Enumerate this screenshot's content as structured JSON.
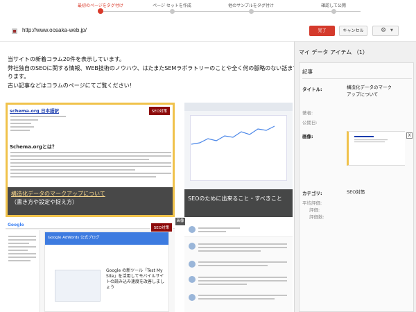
{
  "stepper": {
    "steps": [
      "最初のページをタグ付け",
      "ページ セットを作成",
      "他のサンプルをタグ付け",
      "確認して公開"
    ],
    "active_index": 0,
    "accent": "#d93a2b"
  },
  "toolbar": {
    "url": "http://www.oosaka-web.jp/",
    "done_label": "完了",
    "cancel_label": "キャンセル",
    "gear_icon": "gear-icon"
  },
  "page": {
    "lines": [
      "当サイトの新着コラム20件を表示しています。",
      "弊社独自のSEOに関する情報、WEB技術のノウハウ、はたまたSEMラボラトリーのことや全く何の脈略のない話まで",
      "ります。",
      "古い記事などはコラムのページにてご覧ください！"
    ]
  },
  "tiles": [
    {
      "header_title": "schema.org 日本語訳",
      "badge": "SEO対策",
      "heading": "Schema.orgとは？",
      "caption_highlight": "構造化データのマークアップについて",
      "caption_rest": "（書き方や設定や捉え方）",
      "accent": "#f0c24b"
    },
    {
      "caption": "SEOのために出来ること・すべきこと"
    },
    {
      "logo": "Google",
      "badge": "SEO対策",
      "banner": "Google AdWords 公式ブログ",
      "post_title": "Google の新ツール「Test My Site」を活用してモバイルサイトの読み込み速度を改善しましょう"
    },
    {}
  ],
  "image_label": "画像",
  "panel": {
    "title": "マイ データ アイテム （1）",
    "card_heading": "記事",
    "rows": {
      "title_label": "タイトル:",
      "title_value_1": "構造化データのマーク",
      "title_value_2": "アップについて",
      "author_label": "著者:",
      "published_label": "公開日:",
      "image_label": "画像:",
      "category_label": "カテゴリ:",
      "category_value": "SEO対策",
      "avg_rating_label": "平均評価:",
      "rating_label": "評価:",
      "rating_count_label": "評価数:"
    },
    "close_label": "X"
  }
}
